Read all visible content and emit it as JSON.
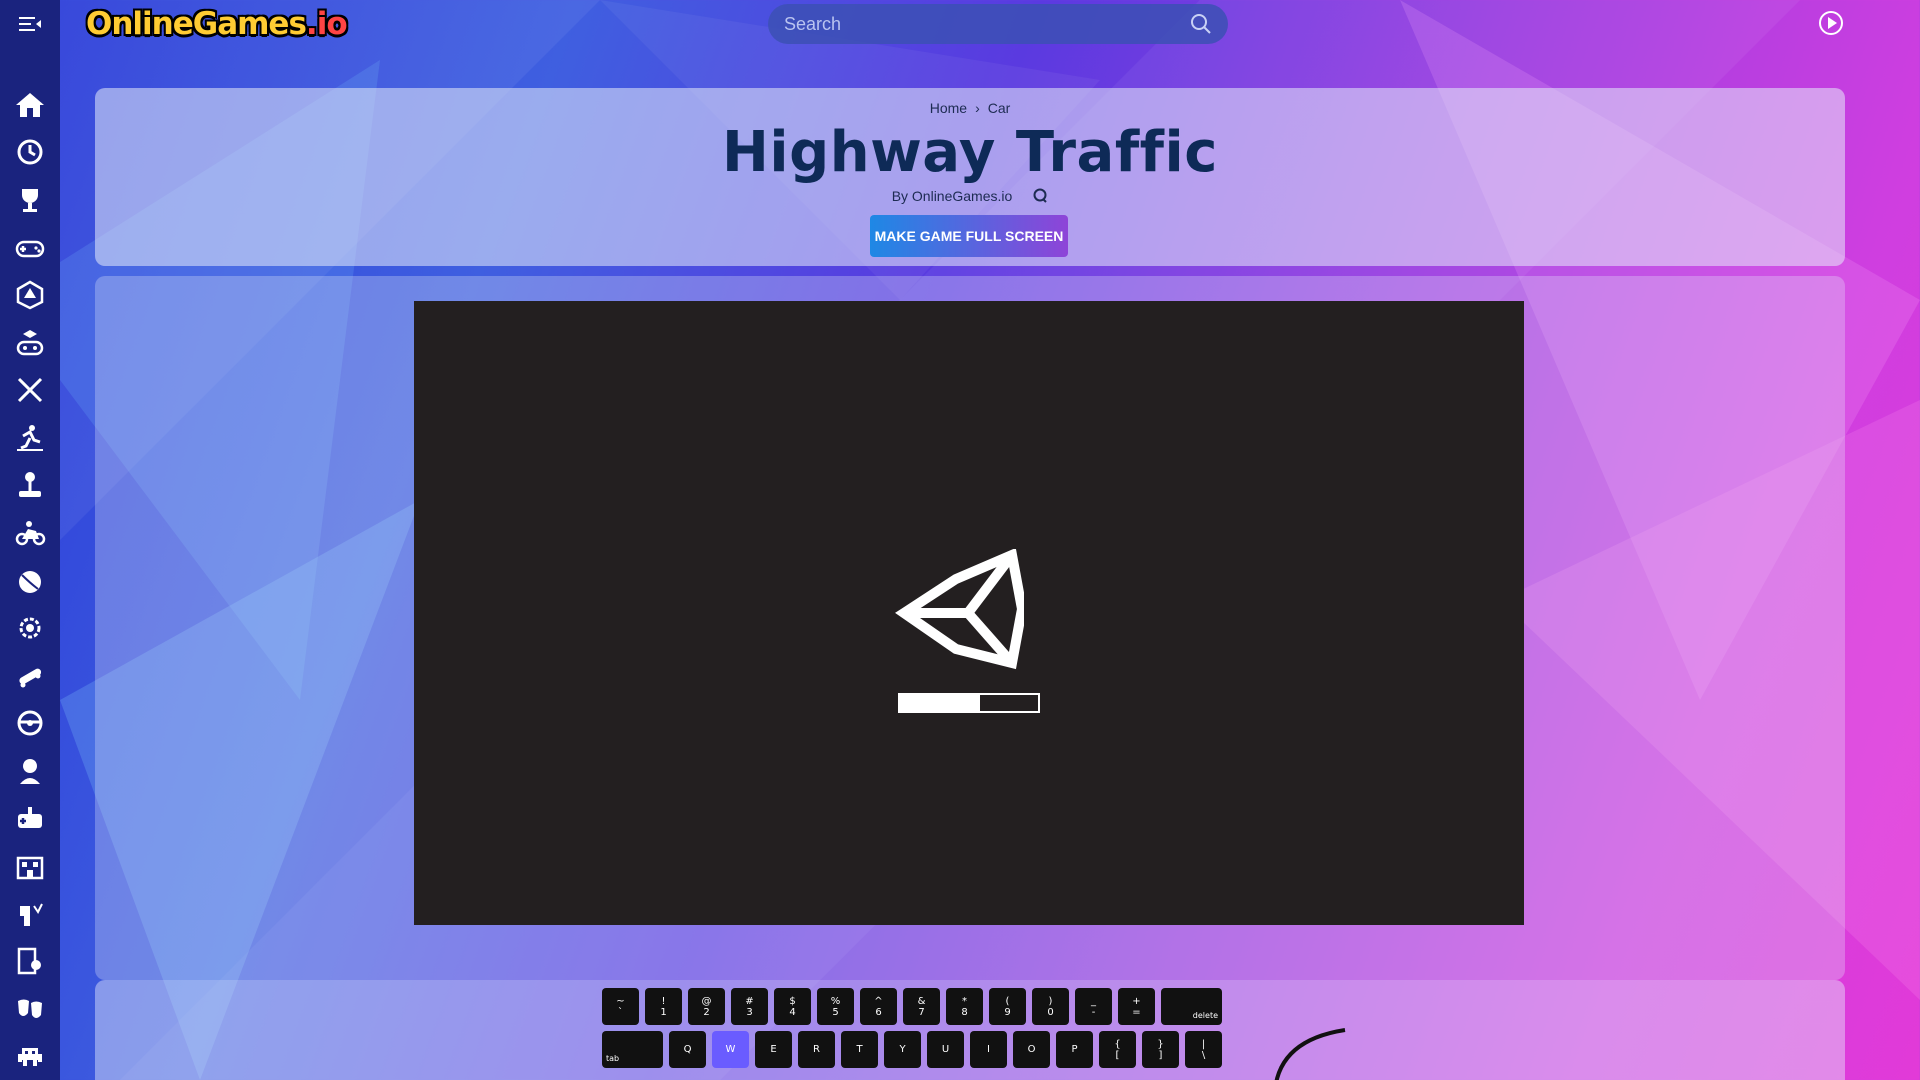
{
  "header": {
    "logo_main": "OnlineGames",
    "logo_suffix": ".io",
    "search_placeholder": "Search"
  },
  "sidebar": {
    "icons": [
      "home-icon",
      "history-icon",
      "trophy-icon",
      "gamepad-icon",
      "dice-icon",
      "puzzle-controller-icon",
      "swords-icon",
      "runner-icon",
      "joystick-icon",
      "motorbike-icon",
      "ball-icon",
      "gear-icon",
      "skateboard-icon",
      "steering-wheel-icon",
      "girl-icon",
      "controller-plus-icon",
      "fort-icon",
      "blocks-icon",
      "board-game-icon",
      "masks-icon",
      "space-invader-icon"
    ]
  },
  "breadcrumb": {
    "home": "Home",
    "separator": "›",
    "category": "Car"
  },
  "game": {
    "title": "Highway Traffic",
    "byline": "By OnlineGames.io",
    "fullscreen_label": "MAKE GAME FULL SCREEN",
    "loading_progress": 0.58
  },
  "keyboard": {
    "row1": [
      [
        "~",
        "`"
      ],
      [
        "!",
        "1"
      ],
      [
        "@",
        "2"
      ],
      [
        "#",
        "3"
      ],
      [
        "$",
        "4"
      ],
      [
        "%",
        "5"
      ],
      [
        "^",
        "6"
      ],
      [
        "&",
        "7"
      ],
      [
        "*",
        "8"
      ],
      [
        "(",
        "9"
      ],
      [
        ")",
        "0"
      ],
      [
        "_",
        "-"
      ],
      [
        "+",
        "="
      ]
    ],
    "row1_end": "delete",
    "row2_start": "tab",
    "row2": [
      "Q",
      "W",
      "E",
      "R",
      "T",
      "Y",
      "U",
      "I",
      "O",
      "P"
    ],
    "row2_pairs": [
      [
        "{",
        "["
      ],
      [
        "}",
        "]"
      ],
      [
        "|",
        "\\"
      ]
    ],
    "highlighted": [
      "W"
    ]
  },
  "colors": {
    "sidebar": "#1a237e",
    "title": "#0e2a57",
    "key_highlight": "#6a5cff"
  }
}
